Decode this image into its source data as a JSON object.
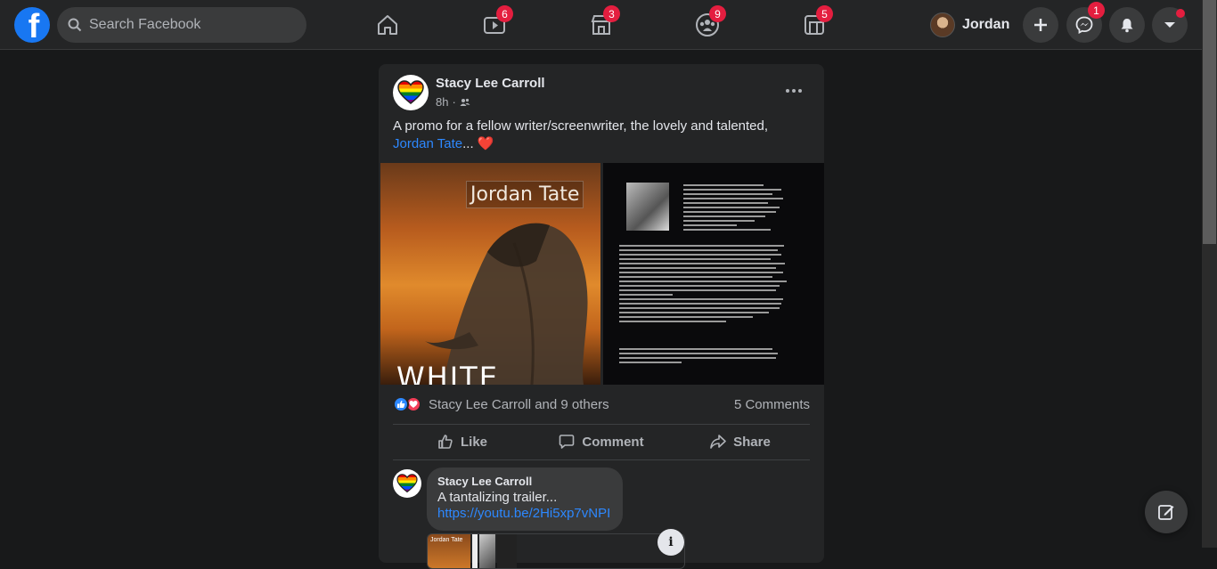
{
  "header": {
    "logo_letter": "f",
    "search_placeholder": "Search Facebook",
    "nav": [
      {
        "name": "home",
        "icon": "home-icon",
        "badge": ""
      },
      {
        "name": "watch",
        "icon": "watch-icon",
        "badge": "6"
      },
      {
        "name": "marketplace",
        "icon": "marketplace-icon",
        "badge": "3"
      },
      {
        "name": "groups",
        "icon": "groups-icon",
        "badge": "9"
      },
      {
        "name": "gaming",
        "icon": "gaming-icon",
        "badge": "5"
      }
    ],
    "profile_name": "Jordan",
    "messenger_badge": "1"
  },
  "post": {
    "author": "Stacy Lee Carroll",
    "time": "8h",
    "text_before": "A promo for a fellow writer/screenwriter, the lovely and talented, ",
    "text_link": "Jordan Tate",
    "text_after": "... ",
    "heart": "❤️",
    "image_left_title": "Jordan Tate",
    "image_left_bottom": "WHITE",
    "reactions_text": "Stacy Lee Carroll and 9 others",
    "comments_count": "5 Comments",
    "actions": {
      "like": "Like",
      "comment": "Comment",
      "share": "Share"
    }
  },
  "comment": {
    "author": "Stacy Lee Carroll",
    "text": "A tantalizing trailer...",
    "link": "https://youtu.be/2Hi5xp7vNPI",
    "preview_title": "Jordan Tate"
  },
  "colors": {
    "accent": "#2d88ff",
    "badge": "#e41e3f",
    "background": "#18191a",
    "card": "#242526"
  }
}
